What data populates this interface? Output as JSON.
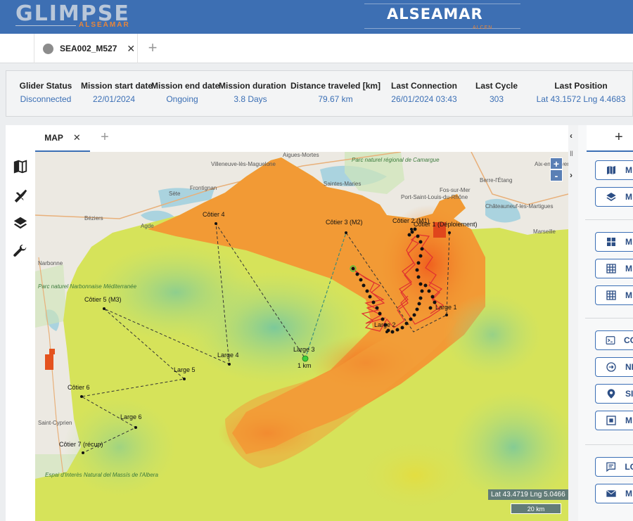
{
  "header": {
    "brand_left": "GLIMPSE",
    "brand_left_sub": "ALSEAMAR",
    "brand_right": "ALSEAMAR",
    "brand_right_sub": "ALCEN",
    "brand_color": "#3d6fb3",
    "accent_color": "#e8863a"
  },
  "tabs": {
    "items": [
      {
        "label": "SEA002_M527",
        "status_dot_color": "#8c8c8c"
      }
    ],
    "close_icon": "close-icon",
    "add_icon": "plus-icon"
  },
  "status": {
    "columns": [
      {
        "label": "Glider Status",
        "value": "Disconnected"
      },
      {
        "label": "Mission start date",
        "value": "22/01/2024"
      },
      {
        "label": "Mission end date",
        "value": "Ongoing"
      },
      {
        "label": "Mission duration",
        "value": "3.8 Days"
      },
      {
        "label": "Distance traveled [km]",
        "value": "79.67 km"
      },
      {
        "label": "Last Connection",
        "value": "26/01/2024 03:43"
      },
      {
        "label": "Last Cycle",
        "value": "303"
      },
      {
        "label": "Last Position",
        "value": "Lat 43.1572 Lng 4.4683"
      }
    ]
  },
  "map_panel": {
    "tab_label": "MAP",
    "zoom_in": "+",
    "zoom_out": "-",
    "coord_readout": "Lat 43.4719 Lng 5.0466",
    "scale": "20 km",
    "side_icons": [
      "map-icon",
      "glider-icon",
      "layers-icon",
      "wrench-icon"
    ],
    "waypoints": [
      {
        "label": "Côtier 1 (Déploiement)"
      },
      {
        "label": "Côtier 2 (M1)"
      },
      {
        "label": "Côtier 3 (M2)"
      },
      {
        "label": "Côtier 4"
      },
      {
        "label": "Côtier 5 (M3)"
      },
      {
        "label": "Côtier 6"
      },
      {
        "label": "Côtier 7 (récup)"
      },
      {
        "label": "Large 1"
      },
      {
        "label": "Large 2"
      },
      {
        "label": "Large 3"
      },
      {
        "label": "Large 4"
      },
      {
        "label": "Large 5"
      },
      {
        "label": "Large 6"
      }
    ],
    "range_label": "1 km",
    "place_names": [
      "Aigues-Mortes",
      "Villeneuve-lès-Maguelone",
      "Frontignan",
      "Sète",
      "Agde",
      "Béziers",
      "Narbonne",
      "Saintes-Maries",
      "Parc naturel régional de Camargue",
      "Port-Saint-Louis-du-Rhône",
      "Fos-sur-Mer",
      "Berre-l'Étang",
      "Châteauneuf-les-Martigues",
      "Marseille",
      "Aix-en-Provence",
      "Parc naturel Narbonnaise Méditerranée",
      "Saint-Cyprien",
      "Espai d'Interès Natural del Massís de l'Albera"
    ]
  },
  "right_panel": {
    "add_icon": "plus-icon",
    "buttons": [
      {
        "icon": "map-icon",
        "label": "M"
      },
      {
        "icon": "layers-icon",
        "label": "M"
      },
      {
        "icon": "dashboard-icon",
        "label": "M"
      },
      {
        "icon": "grid-icon",
        "label": "M"
      },
      {
        "icon": "grid-icon",
        "label": "M"
      },
      {
        "icon": "terminal-icon",
        "label": "CO"
      },
      {
        "icon": "login-icon",
        "label": "NI"
      },
      {
        "icon": "pin-icon",
        "label": "SI"
      },
      {
        "icon": "frame-icon",
        "label": "M"
      },
      {
        "icon": "comment-icon",
        "label": "LO"
      },
      {
        "icon": "mail-icon",
        "label": "M"
      }
    ]
  }
}
